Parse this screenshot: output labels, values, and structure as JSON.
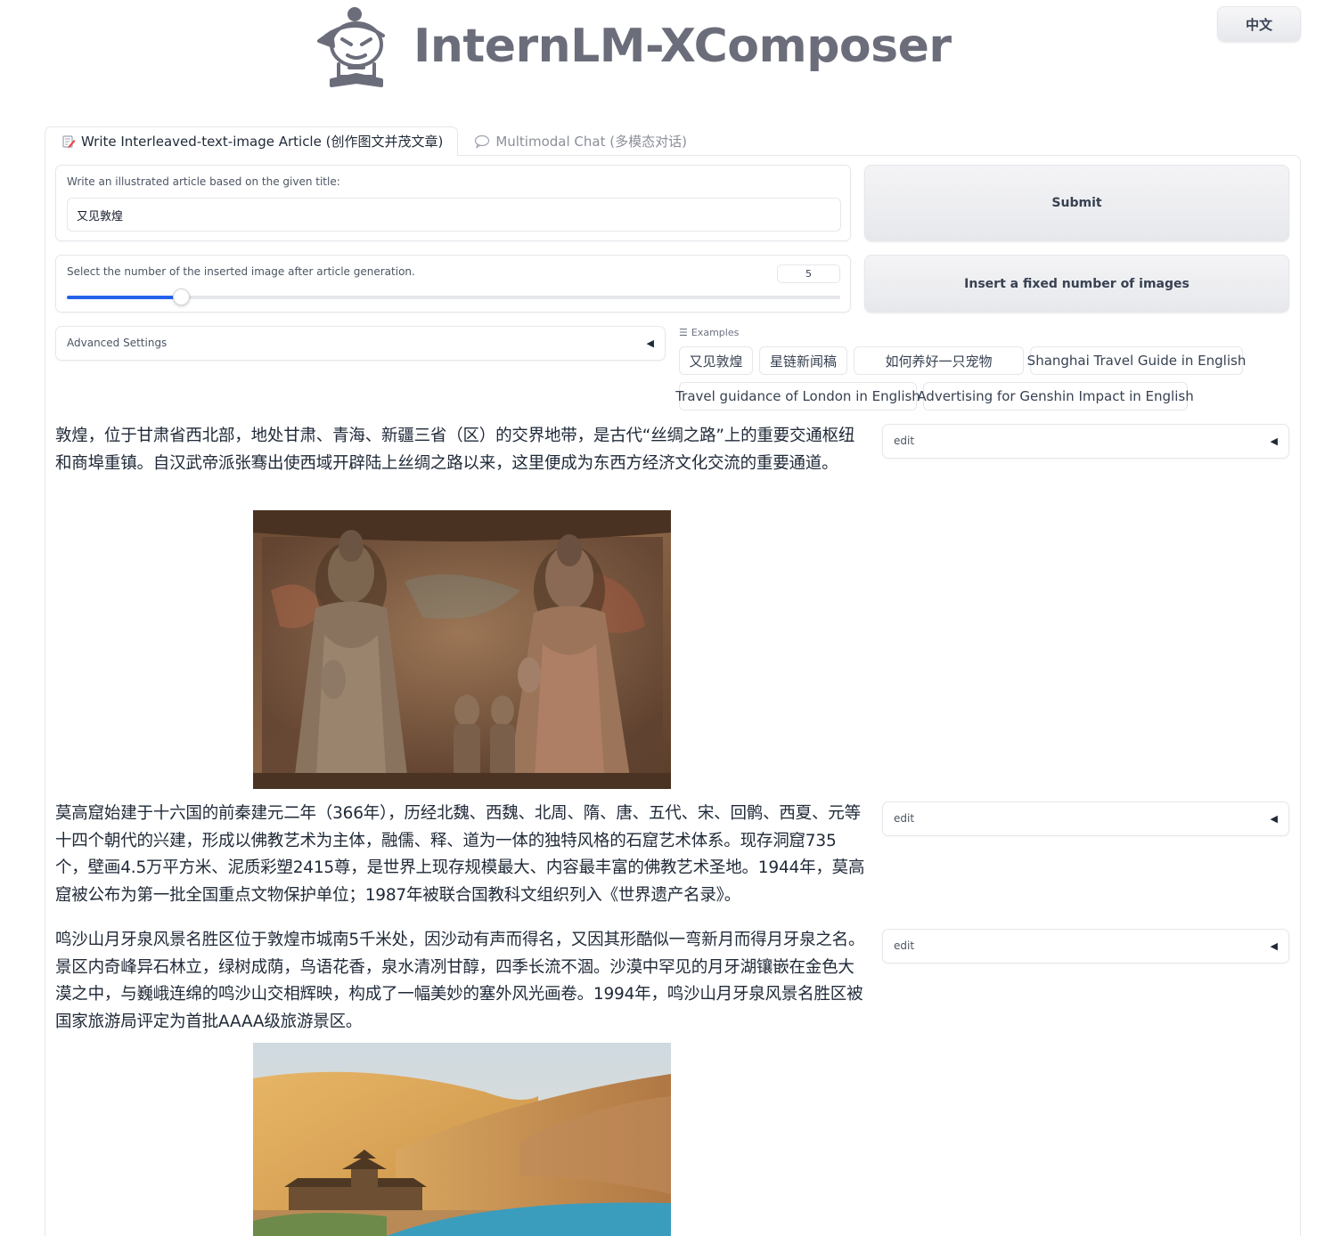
{
  "header": {
    "app_title": "InternLM-XComposer",
    "lang_button": "中文"
  },
  "tabs": [
    {
      "label": "Write Interleaved-text-image Article (创作图文并茂文章)",
      "icon": "edit-icon"
    },
    {
      "label": "Multimodal Chat (多模态对话)",
      "icon": "chat-bubble-icon"
    }
  ],
  "form": {
    "title_label": "Write an illustrated article based on the given title:",
    "title_value": "又见敦煌",
    "slider_label": "Select the number of the inserted image after article generation.",
    "slider_value": "5",
    "slider_fraction": 0.147,
    "submit_label": "Submit",
    "insert_label": "Insert a fixed number of images",
    "advanced_label": "Advanced Settings"
  },
  "examples": {
    "label": "Examples",
    "items": [
      "又见敦煌",
      "星链新闻稿",
      "如何养好一只宠物",
      "Shanghai Travel Guide in English",
      "Travel guidance of London in English",
      "Advertising for Genshin Impact in English"
    ]
  },
  "article": {
    "edit_label": "edit",
    "paragraphs": [
      "敦煌，位于甘肃省西北部，地处甘肃、青海、新疆三省（区）的交界地带，是古代“丝绸之路”上的重要交通枢纽和商埠重镇。自汉武帝派张骞出使西域开辟陆上丝绸之路以来，这里便成为东西方经济文化交流的重要通道。",
      "莫高窟始建于十六国的前秦建元二年（366年），历经北魏、西魏、北周、隋、唐、五代、宋、回鹘、西夏、元等十四个朝代的兴建，形成以佛教艺术为主体，融儒、释、道为一体的独特风格的石窟艺术体系。现存洞窟735个，壁画4.5万平方米、泥质彩塑2415尊，是世界上现存规模最大、内容最丰富的佛教艺术圣地。1944年，莫高窟被公布为第一批全国重点文物保护单位；1987年被联合国教科文组织列入《世界遗产名录》。",
      "鸣沙山月牙泉风景名胜区位于敦煌市城南5千米处，因沙动有声而得名，又因其形酷似一弯新月而得月牙泉之名。景区内奇峰异石林立，绿树成荫，鸟语花香，泉水清冽甘醇，四季长流不涸。沙漠中罕见的月牙湖镶嵌在金色大漠之中，与巍峨连绵的鸣沙山交相辉映，构成了一幅美妙的塞外风光画卷。1994年，鸣沙山月牙泉风景名胜区被国家旅游局评定为首批AAAA级旅游景区。"
    ]
  }
}
